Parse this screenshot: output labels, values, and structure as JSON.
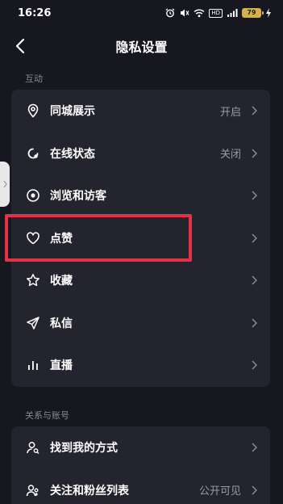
{
  "status_bar": {
    "time": "16:26",
    "network_badge": "HD",
    "battery_level": "79"
  },
  "nav": {
    "title": "隐私设置"
  },
  "sections": {
    "interaction": {
      "label": "互动",
      "items": [
        {
          "label": "同城展示",
          "value": "开启",
          "icon": "location-pin-icon"
        },
        {
          "label": "在线状态",
          "value": "关闭",
          "icon": "online-status-icon"
        },
        {
          "label": "浏览和访客",
          "value": "",
          "icon": "eye-icon"
        },
        {
          "label": "点赞",
          "value": "",
          "icon": "heart-icon"
        },
        {
          "label": "收藏",
          "value": "",
          "icon": "star-icon"
        },
        {
          "label": "私信",
          "value": "",
          "icon": "paper-plane-icon"
        },
        {
          "label": "直播",
          "value": "",
          "icon": "live-bars-icon"
        }
      ]
    },
    "relations": {
      "label": "关系与账号",
      "items": [
        {
          "label": "找到我的方式",
          "value": "",
          "icon": "find-user-icon"
        },
        {
          "label": "关注和粉丝列表",
          "value": "公开可见",
          "icon": "followers-icon"
        }
      ]
    }
  },
  "colors": {
    "background": "#16171f",
    "card": "#23242d",
    "highlight": "#e53144",
    "secondary_text": "#9a9ba3"
  }
}
